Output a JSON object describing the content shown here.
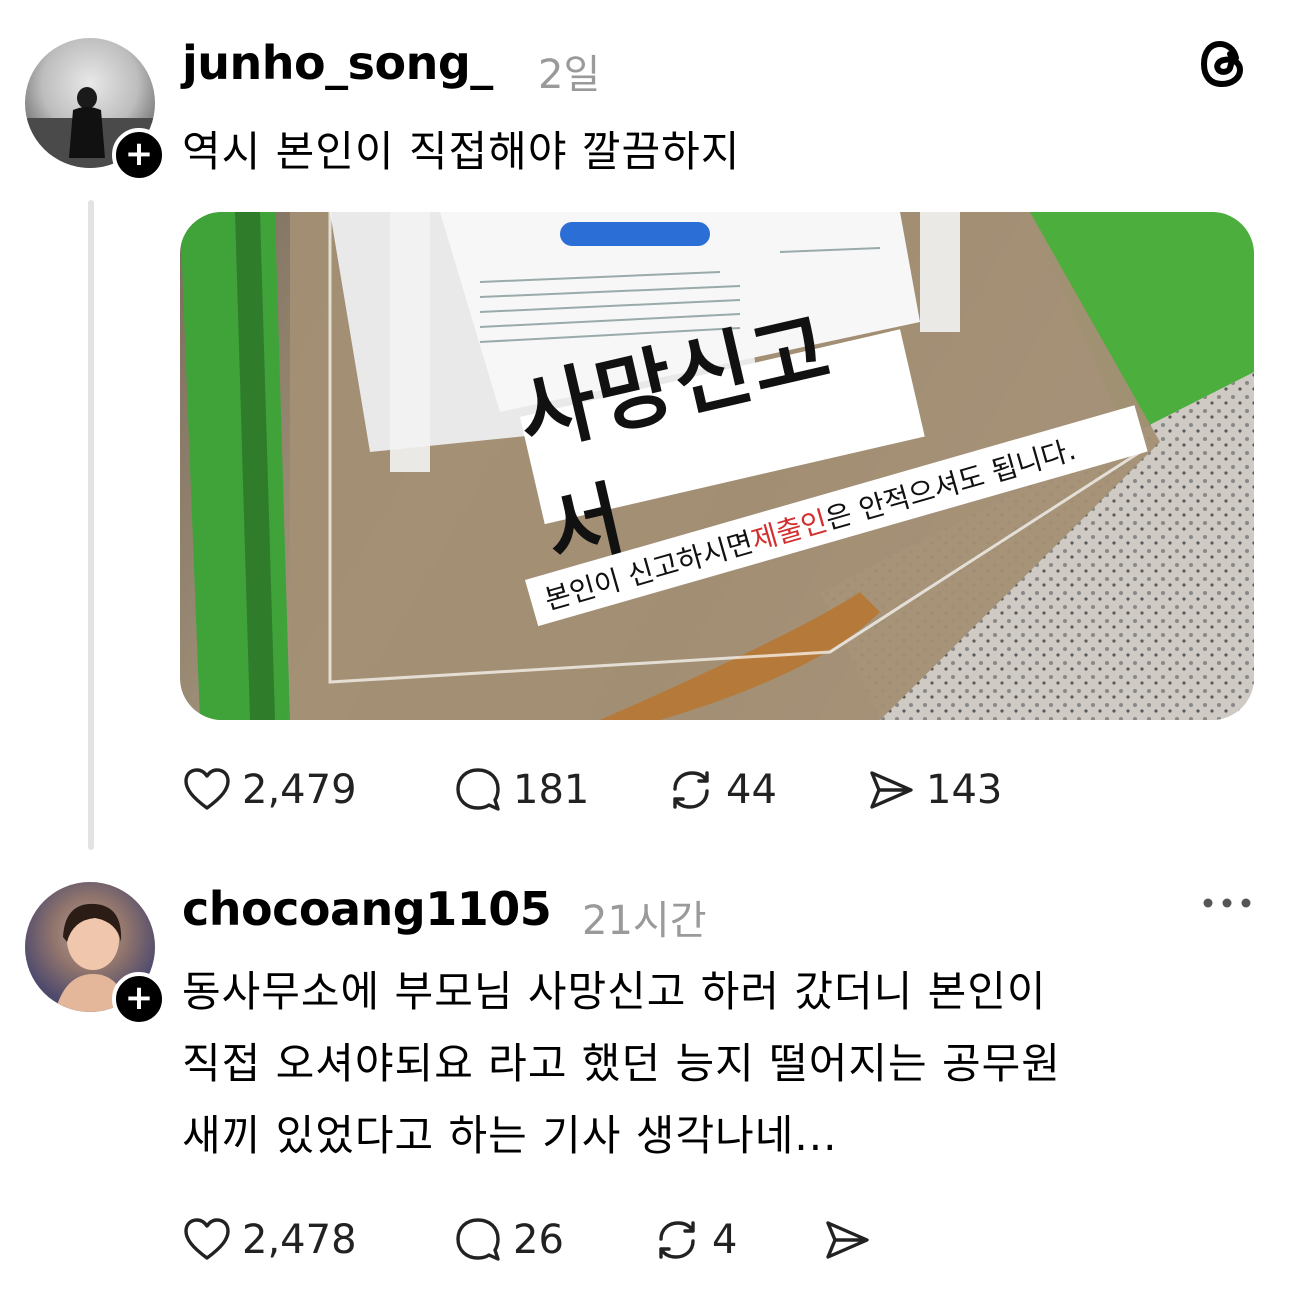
{
  "post1": {
    "username": "junho_song_",
    "time": "2일",
    "text": "역시 본인이 직접해야 깔끔하지",
    "photo": {
      "heading": "사망신고서",
      "line_prefix": "본인이 신고하시면 ",
      "line_highlight": "제출인",
      "line_suffix": "은 안적으셔도 됩니다."
    },
    "stats": {
      "likes": "2,479",
      "comments": "181",
      "reposts": "44",
      "shares": "143"
    }
  },
  "post2": {
    "username": "chocoang1105",
    "time": "21시간",
    "lines": [
      "동사무소에 부모님 사망신고 하러 갔더니 본인이",
      "직접 오셔야되요 라고 했던 능지 떨어지는 공무원",
      "새끼 있었다고 하는 기사 생각나네..."
    ],
    "stats": {
      "likes": "2,478",
      "comments": "26",
      "reposts": "4"
    }
  },
  "icons": {
    "brand": "threads-logo-icon",
    "follow": "plus-icon",
    "like": "heart-icon",
    "comment": "comment-icon",
    "repost": "repost-icon",
    "share": "send-icon",
    "more": "more-dots-icon"
  },
  "colors": {
    "time": "#9a9a9a",
    "badge": "#000000",
    "highlight": "#d32f2f",
    "photo_green": "#3fa33a"
  }
}
